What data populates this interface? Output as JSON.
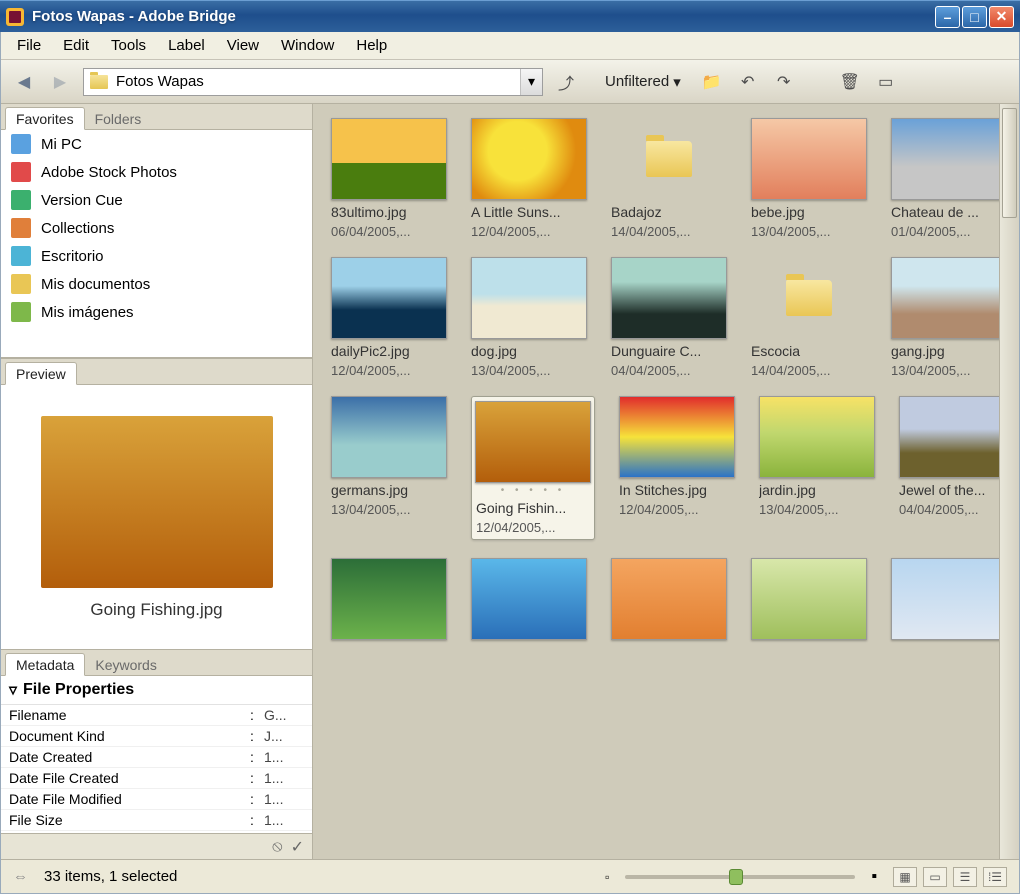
{
  "window": {
    "title": "Fotos Wapas - Adobe Bridge"
  },
  "menubar": [
    "File",
    "Edit",
    "Tools",
    "Label",
    "View",
    "Window",
    "Help"
  ],
  "toolbar": {
    "path": "Fotos Wapas",
    "filter": "Unfiltered"
  },
  "favorites": {
    "tabs": [
      "Favorites",
      "Folders"
    ],
    "items": [
      {
        "label": "Mi PC",
        "icon_color": "#5aa1e0"
      },
      {
        "label": "Adobe Stock Photos",
        "icon_color": "#e14a4a"
      },
      {
        "label": "Version Cue",
        "icon_color": "#3bb06e"
      },
      {
        "label": "Collections",
        "icon_color": "#e07f3a"
      },
      {
        "label": "Escritorio",
        "icon_color": "#4cb4d6"
      },
      {
        "label": "Mis documentos",
        "icon_color": "#e9c655"
      },
      {
        "label": "Mis imágenes",
        "icon_color": "#7eb84a"
      }
    ]
  },
  "preview": {
    "tab": "Preview",
    "caption": "Going Fishing.jpg"
  },
  "metadata": {
    "tabs": [
      "Metadata",
      "Keywords"
    ],
    "section": "File Properties",
    "rows": [
      {
        "k": "Filename",
        "v": "G..."
      },
      {
        "k": "Document Kind",
        "v": "J..."
      },
      {
        "k": "Date Created",
        "v": "1..."
      },
      {
        "k": "Date File Created",
        "v": "1..."
      },
      {
        "k": "Date File Modified",
        "v": "1..."
      },
      {
        "k": "File Size",
        "v": "1..."
      }
    ]
  },
  "thumbs": [
    {
      "name": "83ultimo.jpg",
      "date": "06/04/2005,...",
      "art": "art-tree"
    },
    {
      "name": "A Little Suns...",
      "date": "12/04/2005,...",
      "art": "art-sun"
    },
    {
      "name": "Badajoz",
      "date": "14/04/2005,...",
      "folder": true
    },
    {
      "name": "bebe.jpg",
      "date": "13/04/2005,...",
      "art": "art-bebe"
    },
    {
      "name": "Chateau de ...",
      "date": "01/04/2005,...",
      "art": "art-castle"
    },
    {
      "name": "dailyPic2.jpg",
      "date": "12/04/2005,...",
      "art": "art-daily"
    },
    {
      "name": "dog.jpg",
      "date": "13/04/2005,...",
      "art": "art-dog"
    },
    {
      "name": "Dunguaire C...",
      "date": "04/04/2005,...",
      "art": "art-dung"
    },
    {
      "name": "Escocia",
      "date": "14/04/2005,...",
      "folder": true
    },
    {
      "name": "gang.jpg",
      "date": "13/04/2005,...",
      "art": "art-gang"
    },
    {
      "name": "germans.jpg",
      "date": "13/04/2005,...",
      "art": "art-german"
    },
    {
      "name": "Going Fishin...",
      "date": "12/04/2005,...",
      "art": "art-fish",
      "selected": true
    },
    {
      "name": "In Stitches.jpg",
      "date": "12/04/2005,...",
      "art": "art-stitch"
    },
    {
      "name": "jardin.jpg",
      "date": "13/04/2005,...",
      "art": "art-jardin"
    },
    {
      "name": "Jewel of the...",
      "date": "04/04/2005,...",
      "art": "art-jewel"
    },
    {
      "name": "",
      "date": "",
      "art": "art-row4a"
    },
    {
      "name": "",
      "date": "",
      "art": "art-row4b"
    },
    {
      "name": "",
      "date": "",
      "art": "art-row4c"
    },
    {
      "name": "",
      "date": "",
      "art": "art-row4d"
    },
    {
      "name": "",
      "date": "",
      "art": "art-row4e"
    }
  ],
  "status": {
    "text": "33 items, 1 selected"
  }
}
